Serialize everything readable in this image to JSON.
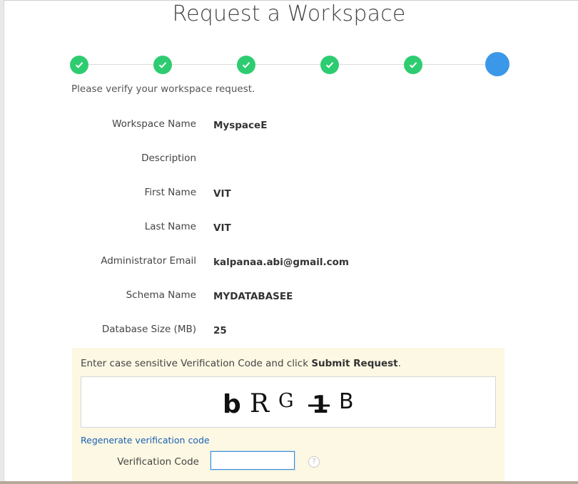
{
  "page": {
    "title": "Request a Workspace",
    "intro": "Please verify your workspace request."
  },
  "progress": {
    "steps": [
      {
        "state": "complete"
      },
      {
        "state": "complete"
      },
      {
        "state": "complete"
      },
      {
        "state": "complete"
      },
      {
        "state": "complete"
      },
      {
        "state": "current"
      }
    ],
    "colors": {
      "complete": "#2ecc71",
      "current": "#3b97e8"
    }
  },
  "fields": [
    {
      "label": "Workspace Name",
      "value": "MyspaceE"
    },
    {
      "label": "Description",
      "value": ""
    },
    {
      "label": "First Name",
      "value": "VIT"
    },
    {
      "label": "Last Name",
      "value": "VIT"
    },
    {
      "label": "Administrator Email",
      "value": "kalpanaa.abi@gmail.com"
    },
    {
      "label": "Schema Name",
      "value": "MYDATABASEE"
    },
    {
      "label": "Database Size (MB)",
      "value": "25"
    }
  ],
  "verification": {
    "instruction_prefix": "Enter case sensitive Verification Code and click ",
    "instruction_bold": "Submit Request",
    "instruction_suffix": ".",
    "captcha_chars": [
      "b",
      "R",
      "G",
      "1",
      "B"
    ],
    "regenerate_link": "Regenerate verification code",
    "code_label": "Verification Code",
    "code_value": "",
    "help_icon": "question-circle-icon",
    "panel_color": "#fcf8e3"
  }
}
